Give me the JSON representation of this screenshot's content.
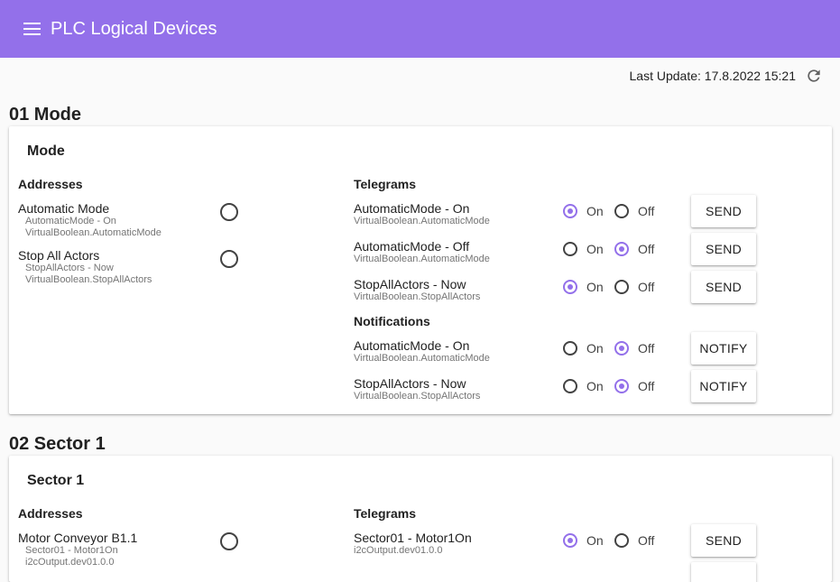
{
  "app": {
    "title": "PLC Logical Devices",
    "accent": "#9370ea"
  },
  "status": {
    "last_update": "Last Update: 17.8.2022 15:21"
  },
  "sections": [
    {
      "title": "01 Mode",
      "card_title": "Mode",
      "addresses_label": "Addresses",
      "addresses": [
        {
          "name": "Automatic Mode",
          "sub1": "AutomaticMode - On",
          "sub2": "VirtualBoolean.AutomaticMode",
          "active": false
        },
        {
          "name": "Stop All Actors",
          "sub1": "StopAllActors - Now",
          "sub2": "VirtualBoolean.StopAllActors",
          "active": false
        }
      ],
      "telegrams_label": "Telegrams",
      "telegrams": [
        {
          "name": "AutomaticMode - On",
          "source": "VirtualBoolean.AutomaticMode",
          "on_label": "On",
          "off_label": "Off",
          "value": "On",
          "button": "SEND"
        },
        {
          "name": "AutomaticMode - Off",
          "source": "VirtualBoolean.AutomaticMode",
          "on_label": "On",
          "off_label": "Off",
          "value": "Off",
          "button": "SEND"
        },
        {
          "name": "StopAllActors - Now",
          "source": "VirtualBoolean.StopAllActors",
          "on_label": "On",
          "off_label": "Off",
          "value": "On",
          "button": "SEND"
        }
      ],
      "notifications_label": "Notifications",
      "notifications": [
        {
          "name": "AutomaticMode - On",
          "source": "VirtualBoolean.AutomaticMode",
          "on_label": "On",
          "off_label": "Off",
          "value": "Off",
          "button": "NOTIFY"
        },
        {
          "name": "StopAllActors - Now",
          "source": "VirtualBoolean.StopAllActors",
          "on_label": "On",
          "off_label": "Off",
          "value": "Off",
          "button": "NOTIFY"
        }
      ]
    },
    {
      "title": "02 Sector 1",
      "card_title": "Sector 1",
      "addresses_label": "Addresses",
      "addresses": [
        {
          "name": "Motor Conveyor B1.1",
          "sub1": "Sector01 - Motor1On",
          "sub2": "i2cOutput.dev01.0.0",
          "active": false
        }
      ],
      "telegrams_label": "Telegrams",
      "telegrams": [
        {
          "name": "Sector01 - Motor1On",
          "source": "i2cOutput.dev01.0.0",
          "on_label": "On",
          "off_label": "Off",
          "value": "On",
          "button": "SEND"
        }
      ]
    }
  ]
}
